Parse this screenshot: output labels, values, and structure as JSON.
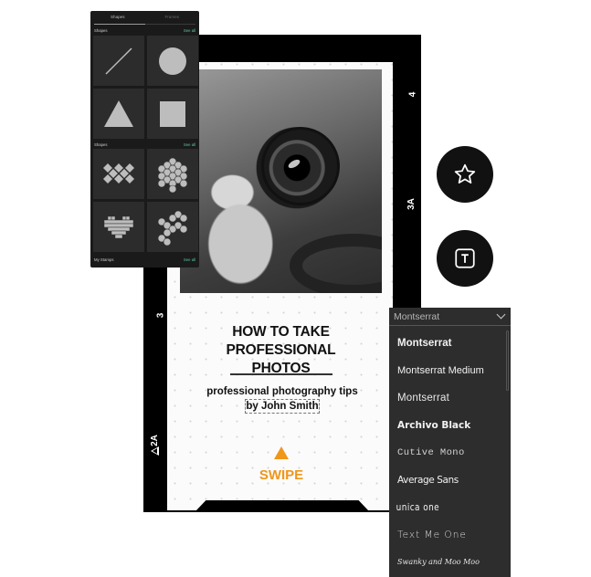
{
  "shapes_panel": {
    "tabs": [
      {
        "label": "Shapes",
        "active": true
      },
      {
        "label": "Frames",
        "active": false
      }
    ],
    "sections": [
      {
        "title": "Shapes",
        "see_all": "See all",
        "items": [
          "line-shape",
          "circle-shape",
          "triangle-shape",
          "square-shape"
        ]
      },
      {
        "title": "Shapes",
        "see_all": "See all",
        "items": [
          "diamond-pattern-shape",
          "hexagon-cluster-shape",
          "pixel-heart-shape",
          "hexagon-scatter-shape"
        ]
      },
      {
        "title": "My Stamps",
        "see_all": "See all"
      }
    ]
  },
  "story_card": {
    "title_lines": [
      "HOW TO TAKE",
      "PROFESSIONAL",
      "PHOTOS"
    ],
    "subtitle": "professional photography tips",
    "byline": "by John Smith",
    "swipe_label": "SWIPE",
    "accent_color": "#f0961a",
    "film_marks": {
      "top_right": "4",
      "mid_right": "3A",
      "left_mid": "3",
      "left_bottom": "2A"
    },
    "photo": "hand-holding-camera-lens-bw-photo"
  },
  "actions": {
    "star_button": "star-icon",
    "text_button": "text-box-icon"
  },
  "font_dropdown": {
    "selected": "Montserrat",
    "options": [
      "Montserrat",
      "Montserrat Medium",
      "Montserrat",
      "Archivo Black",
      "Cutive Mono",
      "Average Sans",
      "unica one",
      "Text Me One",
      "Swanky and Moo Moo"
    ]
  }
}
